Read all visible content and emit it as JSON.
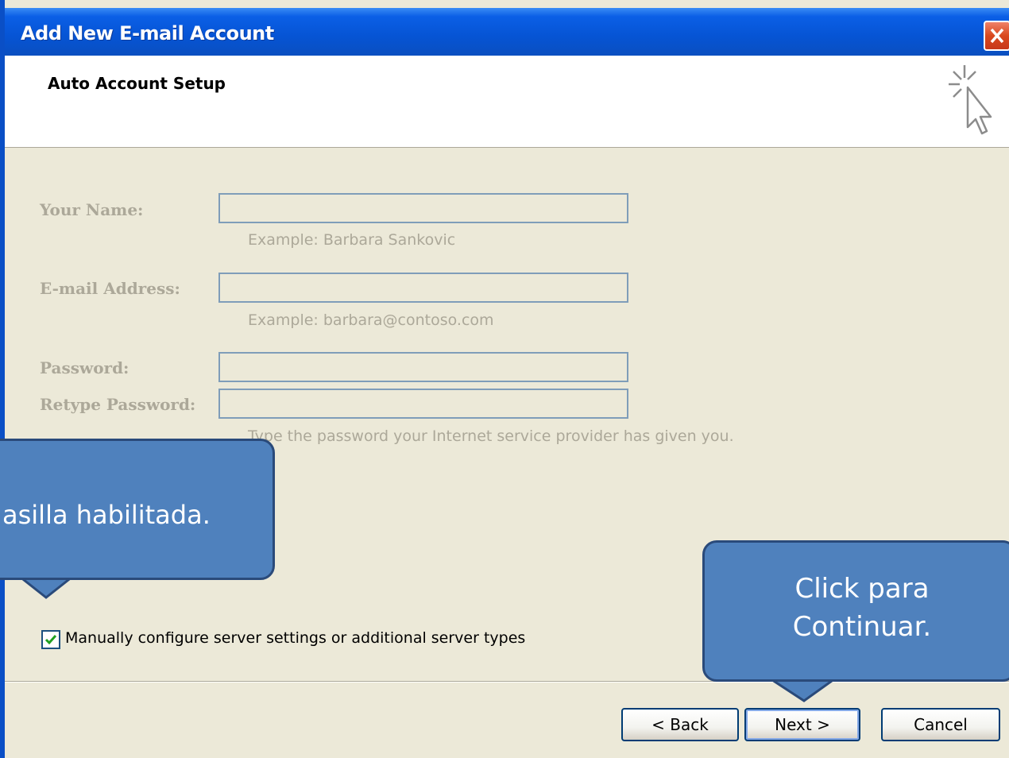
{
  "window": {
    "title": "Add New E-mail Account"
  },
  "header": {
    "title": "Auto Account Setup",
    "icon": "sparkle-cursor-icon"
  },
  "form": {
    "name_label": "Your Name:",
    "name_value": "",
    "name_example": "Example: Barbara Sankovic",
    "email_label": "E-mail Address:",
    "email_value": "",
    "email_example": "Example: barbara@contoso.com",
    "password_label": "Password:",
    "password_value": "",
    "retype_label": "Retype Password:",
    "retype_value": "",
    "password_hint": "Type the password your Internet service provider has given you."
  },
  "manual_config": {
    "checked": true,
    "label": "Manually configure server settings or additional server types"
  },
  "buttons": {
    "back": "< Back",
    "next": "Next >",
    "cancel": "Cancel"
  },
  "callouts": {
    "left": "asilla habilitada.",
    "right_line1": "Click para",
    "right_line2": "Continuar."
  },
  "colors": {
    "title_bar": "#0654d4",
    "dialog_bg": "#ece9d8",
    "callout_fill": "#4f81bd",
    "close_button": "#d9491e"
  }
}
